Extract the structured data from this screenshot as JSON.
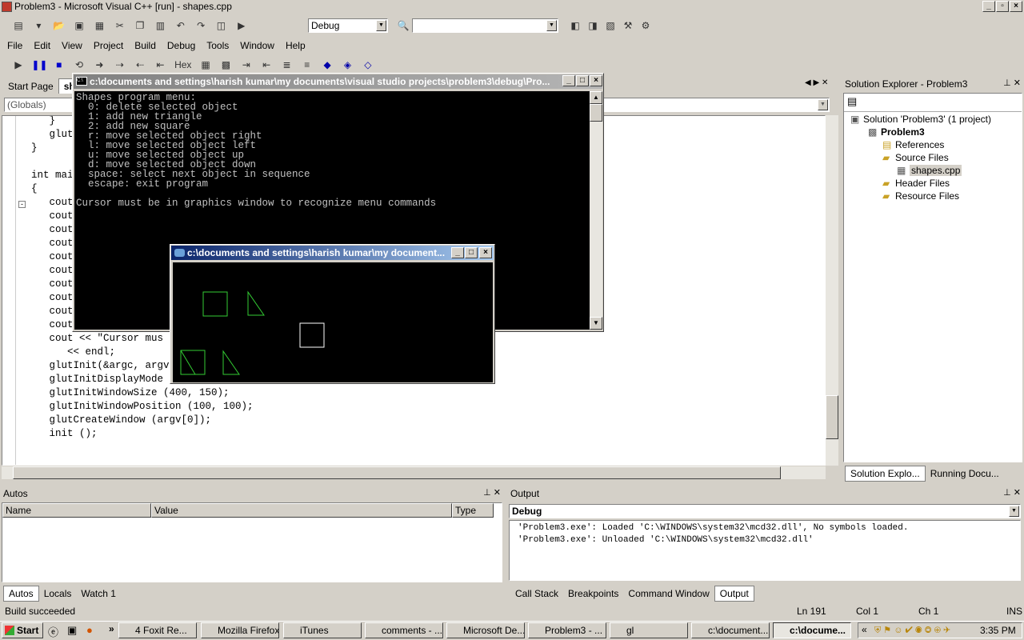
{
  "window_title": "Problem3 - Microsoft Visual C++ [run] - shapes.cpp",
  "toolbar": {
    "config_value": "Debug",
    "hex_label": "Hex"
  },
  "menu": [
    "File",
    "Edit",
    "View",
    "Project",
    "Build",
    "Debug",
    "Tools",
    "Window",
    "Help"
  ],
  "editor": {
    "tabs": [
      "Start Page",
      "sh"
    ],
    "scope_combo": "(Globals)",
    "code_lines": [
      "   }",
      "   glut",
      "}",
      "",
      "int mai",
      "{",
      "   cout",
      "   cout",
      "   cout",
      "   cout",
      "   cout",
      "   cout",
      "   cout",
      "   cout",
      "   cout << \"  space: s",
      "   cout << \"  escape:",
      "   cout << \"Cursor mus",
      "      << endl;",
      "   glutInit(&argc, argv);",
      "   glutInitDisplayMode (GLUT_SINGLE | GLUT_RGB);",
      "   glutInitWindowSize (400, 150);",
      "   glutInitWindowPosition (100, 100);",
      "   glutCreateWindow (argv[0]);",
      "   init ();"
    ]
  },
  "console_window": {
    "title": "c:\\documents and settings\\harish kumar\\my documents\\visual studio projects\\problem3\\debug\\Pro...",
    "lines": [
      "Shapes program menu:",
      "  0: delete selected object",
      "  1: add new triangle",
      "  2: add new square",
      "  r: move selected object right",
      "  l: move selected object left",
      "  u: move selected object up",
      "  d: move selected object down",
      "  space: select next object in sequence",
      "  escape: exit program",
      "",
      "Cursor must be in graphics window to recognize menu commands"
    ]
  },
  "graphics_window": {
    "title": "c:\\documents and settings\\harish kumar\\my document..."
  },
  "solution_explorer": {
    "title": "Solution Explorer - Problem3",
    "items": [
      {
        "label": "Solution 'Problem3' (1 project)",
        "indent": 0
      },
      {
        "label": "Problem3",
        "indent": 1
      },
      {
        "label": "References",
        "indent": 2
      },
      {
        "label": "Source Files",
        "indent": 2
      },
      {
        "label": "shapes.cpp",
        "indent": 3
      },
      {
        "label": "Header Files",
        "indent": 2
      },
      {
        "label": "Resource Files",
        "indent": 2
      }
    ],
    "tabs": [
      "Solution Explo...",
      "Running Docu..."
    ]
  },
  "autos": {
    "title": "Autos",
    "columns": [
      "Name",
      "Value",
      "Type"
    ],
    "tabs": [
      "Autos",
      "Locals",
      "Watch 1"
    ]
  },
  "output": {
    "title": "Output",
    "combo": "Debug",
    "lines": [
      "'Problem3.exe': Loaded 'C:\\WINDOWS\\system32\\mcd32.dll', No symbols loaded.",
      "'Problem3.exe': Unloaded 'C:\\WINDOWS\\system32\\mcd32.dll'"
    ],
    "tabs": [
      "Call Stack",
      "Breakpoints",
      "Command Window",
      "Output"
    ]
  },
  "statusbar": {
    "text": "Build succeeded",
    "ln": "Ln 191",
    "col": "Col 1",
    "ch": "Ch 1",
    "ins": "INS"
  },
  "taskbar": {
    "start": "Start",
    "tasks": [
      "4 Foxit Re...",
      "Mozilla Firefox",
      "iTunes",
      "comments - ...",
      "Microsoft De...",
      "Problem3 - ...",
      "gl",
      "c:\\document...",
      "c:\\docume..."
    ],
    "clock": "3:35 PM"
  },
  "colors": {
    "shape_green": "#33cc33",
    "shape_white": "#ffffff",
    "titlebar_active": "#0a246a"
  }
}
